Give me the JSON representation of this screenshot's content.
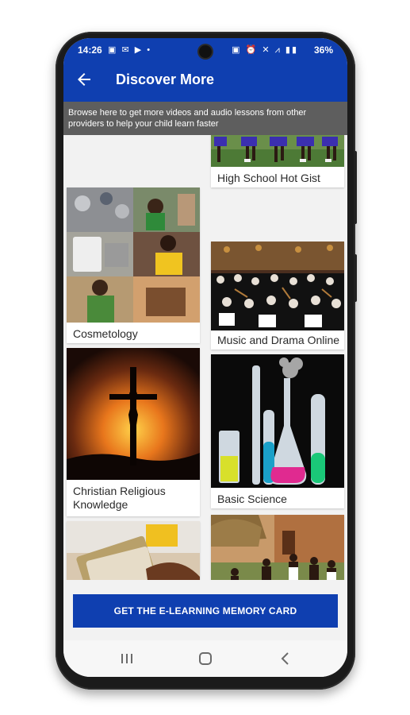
{
  "status_bar": {
    "time": "14:26",
    "left_icons": "▣ ✉ ▶ •",
    "right_icons": "▣ ⏰ ✕ ⩘ ▮▮",
    "battery": "36%"
  },
  "app_bar": {
    "title": "Discover More",
    "back_icon": "arrow-left-icon"
  },
  "banner_text": "Browse here to get more videos and audio lessons from other providers to help your child learn faster",
  "cards": [
    {
      "label": "High School Hot Gist",
      "image": "students-running-photo"
    },
    {
      "label": "Cosmetology",
      "image": "cosmetology-collage-photo"
    },
    {
      "label": "Music and Drama Online",
      "image": "orchestra-photo"
    },
    {
      "label": "Christian Religious Knowledge",
      "image": "crucifix-sunset-photo"
    },
    {
      "label": "Basic Science",
      "image": "lab-flasks-photo"
    },
    {
      "label": "",
      "image": "money-counting-photo"
    },
    {
      "label": "",
      "image": "village-photo"
    }
  ],
  "cta": {
    "label": "GET THE E-LEARNING MEMORY CARD"
  },
  "nav": {
    "recents": "recents-icon",
    "home": "home-icon",
    "back": "back-icon"
  },
  "colors": {
    "primary": "#0f3fb0",
    "banner": "#5e5e5e",
    "background": "#f2f2f2"
  }
}
